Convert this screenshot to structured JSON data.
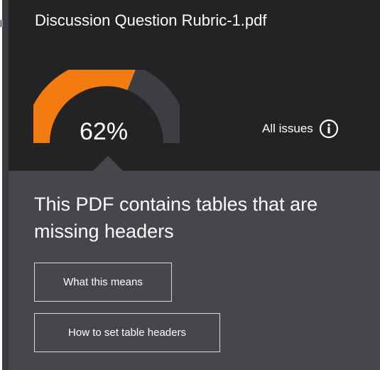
{
  "panel": {
    "file_title": "Discussion Question Rubric-1.pdf"
  },
  "score": {
    "percent": 62,
    "label": "62%",
    "colors": {
      "filled": "#f47b0f",
      "remaining": "#3d3e43"
    }
  },
  "issues_link": {
    "label": "All issues",
    "icon": "info-icon"
  },
  "issue": {
    "headline": "This PDF contains tables that are missing headers"
  },
  "buttons": {
    "what_this_means": "What this means",
    "how_to_set_headers": "How to set table headers"
  },
  "colors": {
    "top_background": "#232323",
    "panel_background": "#46474b",
    "text": "#ffffff"
  }
}
